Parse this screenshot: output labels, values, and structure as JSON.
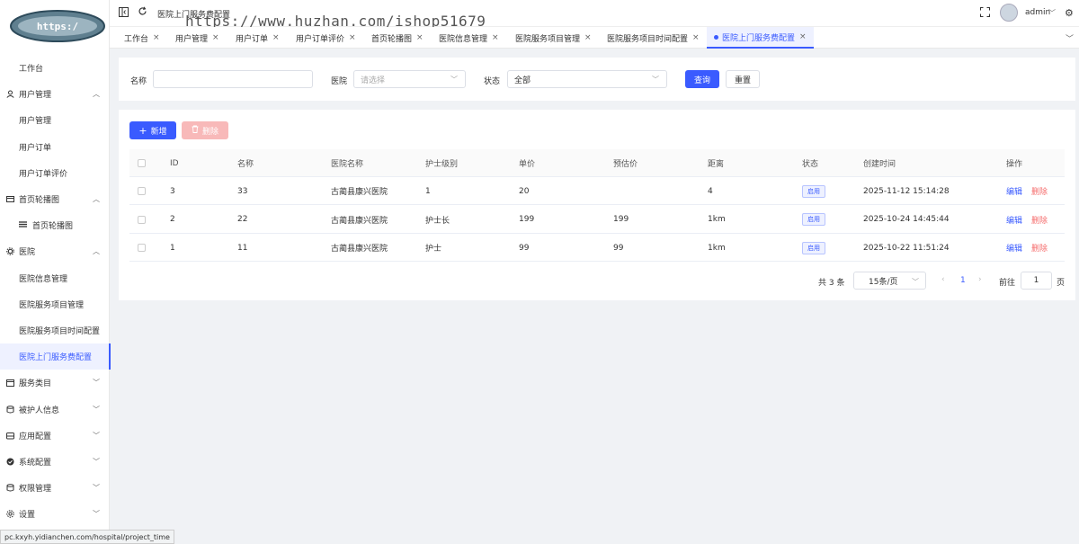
{
  "header": {
    "breadcrumb": "医院上门服务费配置",
    "watermark": "https://www.huzhan.com/ishop51679",
    "user": "admin"
  },
  "sidebar": {
    "items": [
      {
        "label": "工作台",
        "level": "sub"
      },
      {
        "label": "用户管理",
        "level": "top",
        "icon": "user-icon",
        "expanded": true
      },
      {
        "label": "用户管理",
        "level": "sub"
      },
      {
        "label": "用户订单",
        "level": "sub"
      },
      {
        "label": "用户订单评价",
        "level": "sub"
      },
      {
        "label": "首页轮播图",
        "level": "top",
        "icon": "carousel-icon",
        "expanded": true
      },
      {
        "label": "首页轮播图",
        "level": "sub2",
        "icon": "list-icon"
      },
      {
        "label": "医院",
        "level": "top",
        "icon": "hospital-gear-icon",
        "expanded": true
      },
      {
        "label": "医院信息管理",
        "level": "sub"
      },
      {
        "label": "医院服务项目管理",
        "level": "sub"
      },
      {
        "label": "医院服务项目时间配置",
        "level": "sub"
      },
      {
        "label": "医院上门服务费配置",
        "level": "sub",
        "active": true
      },
      {
        "label": "服务类目",
        "level": "top",
        "icon": "calendar-icon",
        "expanded": false
      },
      {
        "label": "被护人信息",
        "level": "top",
        "icon": "database-icon",
        "expanded": false
      },
      {
        "label": "应用配置",
        "level": "top",
        "icon": "app-icon",
        "expanded": false
      },
      {
        "label": "系统配置",
        "level": "top",
        "icon": "check-circle-icon",
        "expanded": false
      },
      {
        "label": "权限管理",
        "level": "top",
        "icon": "database-icon",
        "expanded": false
      },
      {
        "label": "设置",
        "level": "top",
        "icon": "settings-icon",
        "expanded": false
      }
    ]
  },
  "tabs": [
    {
      "label": "工作台"
    },
    {
      "label": "用户管理"
    },
    {
      "label": "用户订单"
    },
    {
      "label": "用户订单评价"
    },
    {
      "label": "首页轮播图"
    },
    {
      "label": "医院信息管理"
    },
    {
      "label": "医院服务项目管理"
    },
    {
      "label": "医院服务项目时间配置"
    },
    {
      "label": "医院上门服务费配置",
      "active": true
    }
  ],
  "filter": {
    "name_label": "名称",
    "name_value": "",
    "hospital_label": "医院",
    "hospital_placeholder": "请选择",
    "status_label": "状态",
    "status_value": "全部",
    "search_label": "查询",
    "reset_label": "重置"
  },
  "actions": {
    "add_label": "新增",
    "delete_label": "删除"
  },
  "table": {
    "columns": [
      "ID",
      "名称",
      "医院名称",
      "护士级别",
      "单价",
      "预估价",
      "距离",
      "状态",
      "创建时间",
      "操作"
    ],
    "rows": [
      {
        "id": "3",
        "name": "33",
        "hospital": "古蔺县康兴医院",
        "level": "1",
        "price": "20",
        "estimate": "",
        "distance": "4",
        "status": "启用",
        "created": "2025-11-12 15:14:28",
        "edit": "编辑",
        "delete": "删除"
      },
      {
        "id": "2",
        "name": "22",
        "hospital": "古蔺县康兴医院",
        "level": "护士长",
        "price": "199",
        "estimate": "199",
        "distance": "1km",
        "status": "启用",
        "created": "2025-10-24 14:45:44",
        "edit": "编辑",
        "delete": "删除"
      },
      {
        "id": "1",
        "name": "11",
        "hospital": "古蔺县康兴医院",
        "level": "护士",
        "price": "99",
        "estimate": "99",
        "distance": "1km",
        "status": "启用",
        "created": "2025-10-22 11:51:24",
        "edit": "编辑",
        "delete": "删除"
      }
    ]
  },
  "pagination": {
    "total": "共 3 条",
    "page_size": "15条/页",
    "current_page": "1",
    "goto_label": "前往",
    "goto_value": "1",
    "page_unit": "页"
  },
  "statusbar": {
    "url": "pc.kxyh.yidianchen.com/hospital/project_time"
  },
  "colors": {
    "accent": "#3a5bff",
    "danger": "#f56c6c",
    "danger_disabled": "#f8b9b9"
  }
}
